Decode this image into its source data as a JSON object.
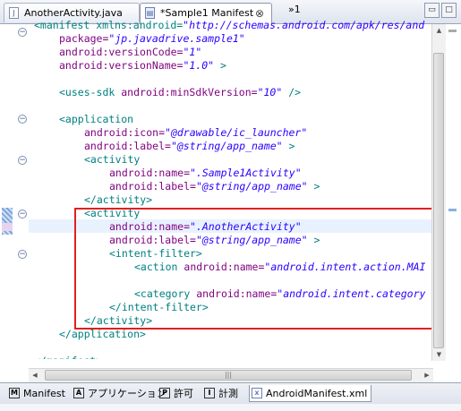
{
  "tabs": [
    {
      "label": "AnotherActivity.java",
      "icon": "java-file-icon"
    },
    {
      "label": "*Sample1 Manifest",
      "icon": "manifest-file-icon",
      "close": "⊗"
    }
  ],
  "overflow_label": "»1",
  "window_buttons": {
    "minimize": "▭",
    "maximize": "□"
  },
  "code_lines": [
    [
      [
        "p",
        "<manifest xmlns:android="
      ],
      [
        "v",
        "\"http://schemas.android.com/apk/res/and"
      ]
    ],
    [
      [
        "a",
        "package="
      ],
      [
        "v",
        "\"jp.javadrive.sample1\""
      ]
    ],
    [
      [
        "a",
        "android:versionCode="
      ],
      [
        "v",
        "\"1\""
      ]
    ],
    [
      [
        "a",
        "android:versionName="
      ],
      [
        "v",
        "\"1.0\""
      ],
      [
        "p",
        " >"
      ]
    ],
    [
      [
        "p",
        ""
      ]
    ],
    [
      [
        "p",
        "<uses-sdk "
      ],
      [
        "a",
        "android:minSdkVersion="
      ],
      [
        "v",
        "\"10\""
      ],
      [
        "p",
        " />"
      ]
    ],
    [
      [
        "p",
        ""
      ]
    ],
    [
      [
        "p",
        "<application"
      ]
    ],
    [
      [
        "a",
        "android:icon="
      ],
      [
        "v",
        "\"@drawable/ic_launcher\""
      ]
    ],
    [
      [
        "a",
        "android:label="
      ],
      [
        "v",
        "\"@string/app_name\""
      ],
      [
        "p",
        " >"
      ]
    ],
    [
      [
        "p",
        "<activity"
      ]
    ],
    [
      [
        "a",
        "android:name="
      ],
      [
        "v",
        "\".Sample1Activity\""
      ]
    ],
    [
      [
        "a",
        "android:label="
      ],
      [
        "v",
        "\"@string/app_name\""
      ],
      [
        "p",
        " >"
      ]
    ],
    [
      [
        "p",
        "</activity>"
      ]
    ],
    [
      [
        "p",
        "<activity"
      ]
    ],
    [
      [
        "a",
        "android:name="
      ],
      [
        "v",
        "\".AnotherActivity\""
      ]
    ],
    [
      [
        "a",
        "android:label="
      ],
      [
        "v",
        "\"@string/app_name\""
      ],
      [
        "p",
        " >"
      ]
    ],
    [
      [
        "p",
        "<intent-filter>"
      ]
    ],
    [
      [
        "p",
        "<action "
      ],
      [
        "a",
        "android:name="
      ],
      [
        "v",
        "\"android.intent.action.MAI"
      ]
    ],
    [
      [
        "p",
        ""
      ]
    ],
    [
      [
        "p",
        "<category "
      ],
      [
        "a",
        "android:name="
      ],
      [
        "v",
        "\"android.intent.category"
      ]
    ],
    [
      [
        "p",
        "</intent-filter>"
      ]
    ],
    [
      [
        "p",
        "</activity>"
      ]
    ],
    [
      [
        "p",
        "</application>"
      ]
    ],
    [
      [
        "p",
        ""
      ]
    ],
    [
      [
        "p",
        "</manifest>"
      ]
    ]
  ],
  "bottom_tabs": [
    {
      "label": "Manifest",
      "icon": "M"
    },
    {
      "label": "アプリケーション",
      "icon": "A"
    },
    {
      "label": "許可",
      "icon": "P"
    },
    {
      "label": "計測",
      "icon": "I"
    },
    {
      "label": "AndroidManifest.xml",
      "icon": "x"
    }
  ]
}
